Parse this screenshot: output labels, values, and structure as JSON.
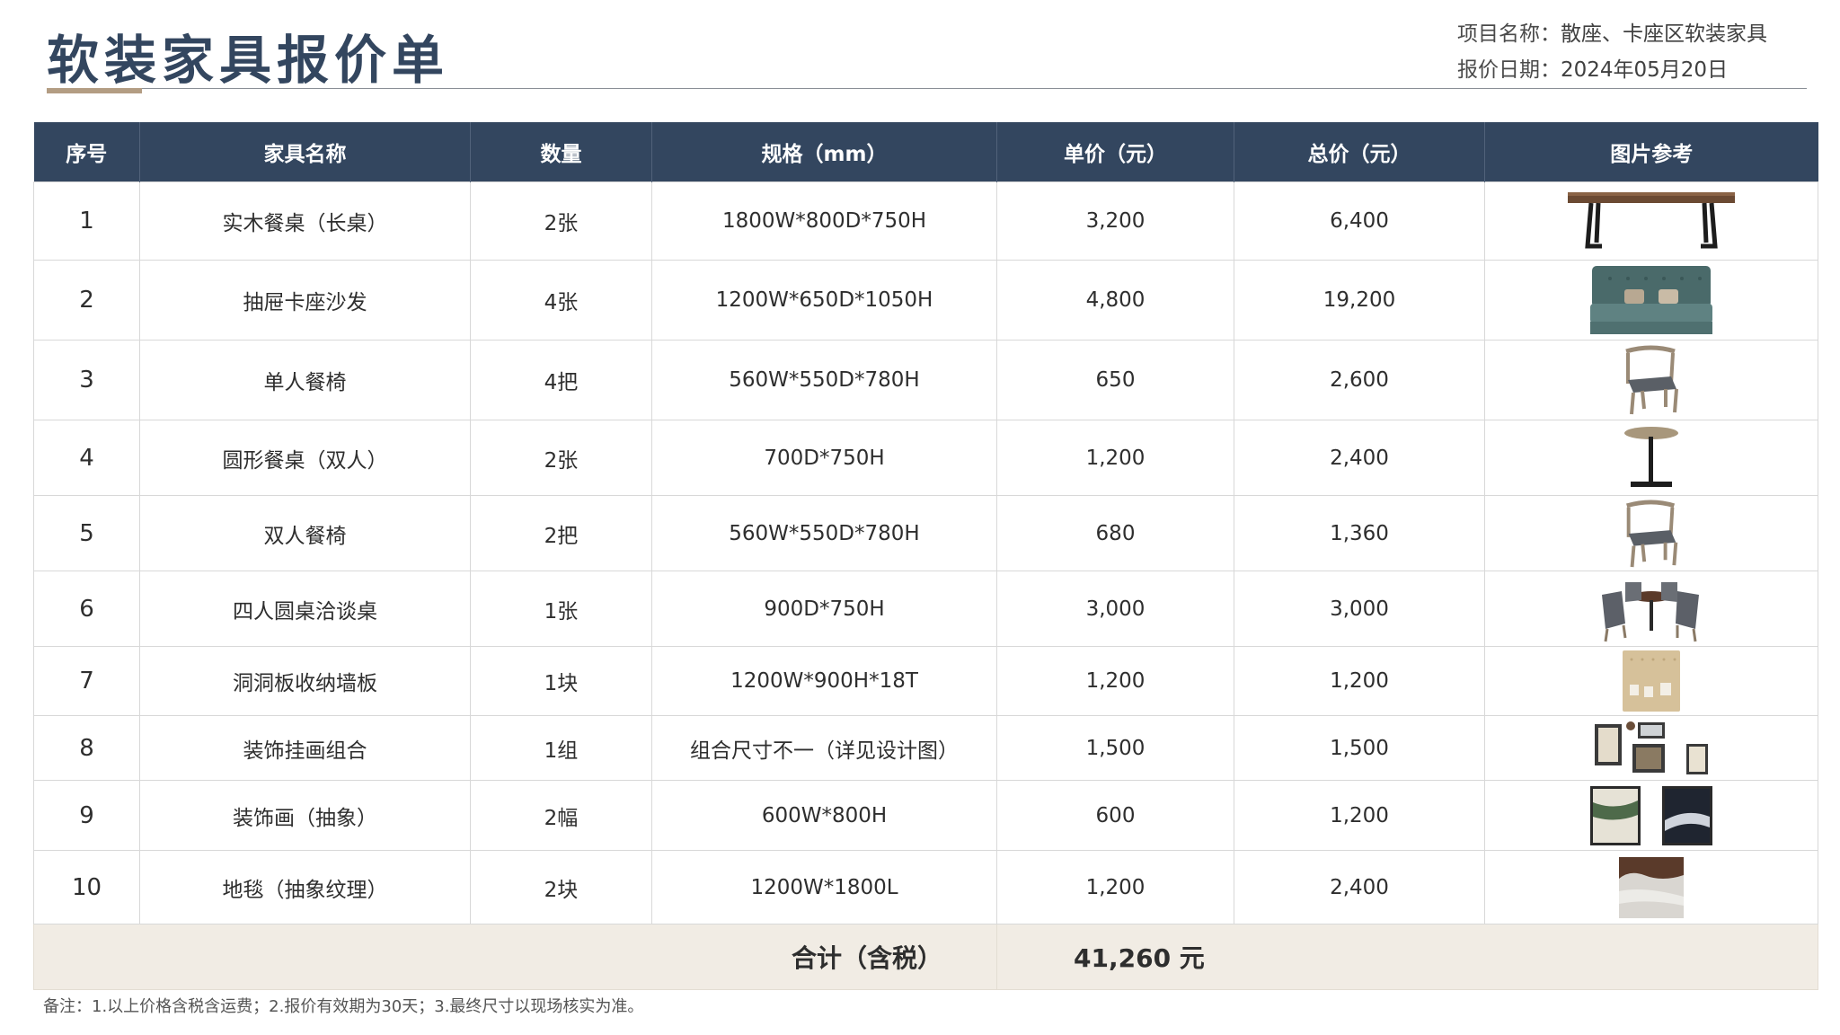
{
  "header": {
    "title": "软装家具报价单",
    "project_label": "项目名称：",
    "project_value": "散座、卡座区软装家具",
    "date_label": "报价日期：",
    "date_value": "2024年05月20日"
  },
  "table": {
    "columns": [
      "序号",
      "家具名称",
      "数量",
      "规格（mm）",
      "单价（元）",
      "总价（元）",
      "图片参考"
    ],
    "rows": [
      {
        "no": "1",
        "name": "实木餐桌（长桌）",
        "qty": "2张",
        "spec": "1800W*800D*750H",
        "unit": "3,200",
        "total": "6,400",
        "icon": "dining-table-icon"
      },
      {
        "no": "2",
        "name": "抽屉卡座沙发",
        "qty": "4张",
        "spec": "1200W*650D*1050H",
        "unit": "4,800",
        "total": "19,200",
        "icon": "booth-sofa-icon"
      },
      {
        "no": "3",
        "name": "单人餐椅",
        "qty": "4把",
        "spec": "560W*550D*780H",
        "unit": "650",
        "total": "2,600",
        "icon": "dining-chair-icon"
      },
      {
        "no": "4",
        "name": "圆形餐桌（双人）",
        "qty": "2张",
        "spec": "700D*750H",
        "unit": "1,200",
        "total": "2,400",
        "icon": "round-table-icon"
      },
      {
        "no": "5",
        "name": "双人餐椅",
        "qty": "2把",
        "spec": "560W*550D*780H",
        "unit": "680",
        "total": "1,360",
        "icon": "dining-chair-icon"
      },
      {
        "no": "6",
        "name": "四人圆桌洽谈桌",
        "qty": "1张",
        "spec": "900D*750H",
        "unit": "3,000",
        "total": "3,000",
        "icon": "meeting-table-set-icon"
      },
      {
        "no": "7",
        "name": "洞洞板收纳墙板",
        "qty": "1块",
        "spec": "1200W*900H*18T",
        "unit": "1,200",
        "total": "1,200",
        "icon": "pegboard-icon"
      },
      {
        "no": "8",
        "name": "装饰挂画组合",
        "qty": "1组",
        "spec": "组合尺寸不一（详见设计图）",
        "unit": "1,500",
        "total": "1,500",
        "icon": "frame-gallery-icon"
      },
      {
        "no": "9",
        "name": "装饰画（抽象）",
        "qty": "2幅",
        "spec": "600W*800H",
        "unit": "600",
        "total": "1,200",
        "icon": "abstract-painting-icon"
      },
      {
        "no": "10",
        "name": "地毯（抽象纹理）",
        "qty": "2块",
        "spec": "1200W*1800L",
        "unit": "1,200",
        "total": "2,400",
        "icon": "rug-icon"
      }
    ],
    "total_label": "合计（含税）",
    "total_value": "41,260 元"
  },
  "note": "备注：1.以上价格含税含运费；2.报价有效期为30天；3.最终尺寸以现场核实为准。"
}
